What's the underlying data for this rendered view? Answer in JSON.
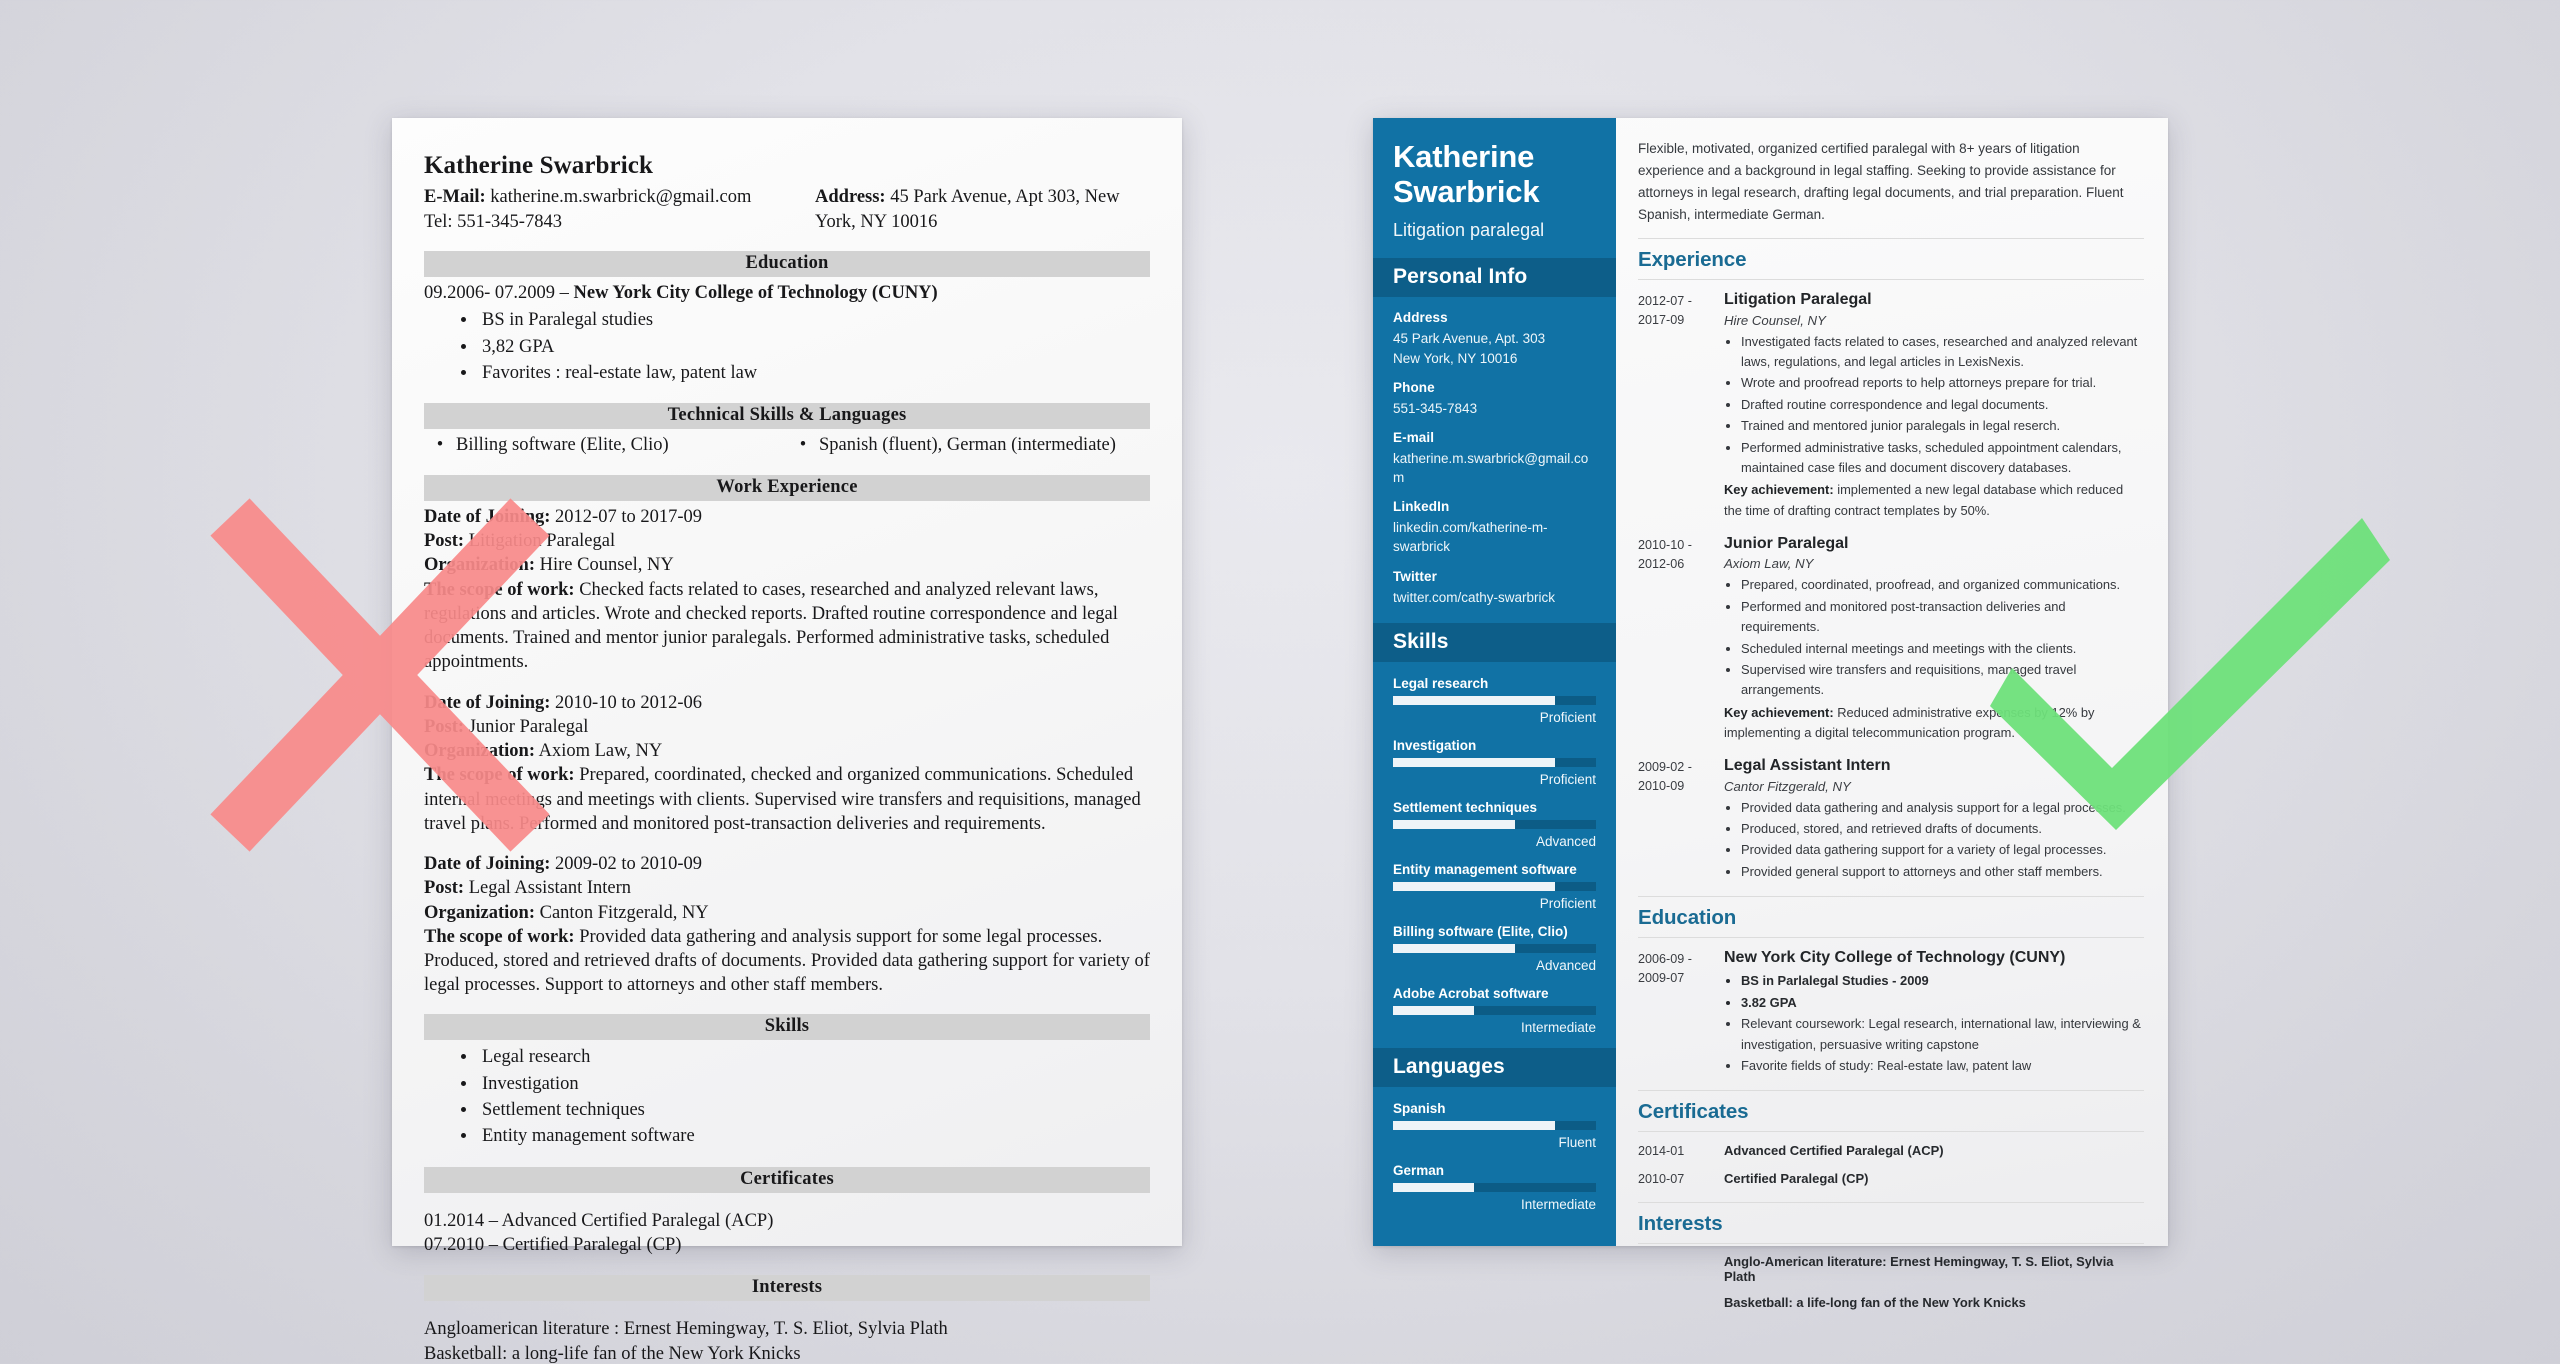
{
  "colors": {
    "sidebar_blue": "#1172a5",
    "sidebar_head_blue": "#0d5e89",
    "heading_blue": "#1a6b93",
    "bad_section_gray": "#d2d2d2",
    "cross_red": "#f98a8a",
    "check_green": "#6ee07a"
  },
  "bad_resume": {
    "name": "Katherine Swarbrick",
    "email_line": "E-Mail: katherine.m.swarbrick@gmail.com",
    "email_label": "E-Mail:",
    "email_value": " katherine.m.swarbrick@gmail.com",
    "tel_line": "Tel: 551-345-7843",
    "address_label": "Address:",
    "address_value": " 45 Park Avenue, Apt 303, New York, NY 10016",
    "sections": {
      "education_head": "Education",
      "education_line": "09.2006- 07.2009 – ",
      "education_school": "New York City College of Technology (CUNY)",
      "education_bullets": [
        "BS in Paralegal studies",
        "3,82 GPA",
        "Favorites : real-estate law, patent law"
      ],
      "tech_head": "Technical Skills & Languages",
      "tech_left": "Billing software (Elite, Clio)",
      "tech_right": "Spanish (fluent), German (intermediate)",
      "work_head": "Work Experience",
      "skills_head": "Skills",
      "skills_bullets": [
        "Legal research",
        "Investigation",
        "Settlement techniques",
        "Entity management software"
      ],
      "certificates_head": "Certificates",
      "certificates_lines": [
        "01.2014 – Advanced Certified Paralegal (ACP)",
        "07.2010 – Certified Paralegal (CP)"
      ],
      "interests_head": "Interests",
      "interests_lines": [
        "Angloamerican literature : Ernest Hemingway, T. S. Eliot, Sylvia Plath",
        "Basketball: a long-life fan of the New York Knicks"
      ]
    },
    "jobs": [
      {
        "date_label": "Date of Joining:",
        "date_value": " 2012-07 to 2017-09",
        "post_label": "Post:",
        "post_value": " Litigation Paralegal",
        "org_label": "Organization:",
        "org_value": " Hire Counsel, NY",
        "scope_label": "The scope of work:",
        "scope_value": " Checked facts related to cases, researched and analyzed relevant laws, regulations and articles. Wrote and checked reports. Drafted routine correspondence and legal documents. Trained and mentor junior paralegals. Performed administrative tasks, scheduled appointments."
      },
      {
        "date_label": "Date of Joining:",
        "date_value": " 2010-10 to 2012-06",
        "post_label": "Post:",
        "post_value": " Junior Paralegal",
        "org_label": "Organization:",
        "org_value": " Axiom Law, NY",
        "scope_label": "The scope of work:",
        "scope_value": " Prepared, coordinated, checked and organized communications. Scheduled internal meetings and meetings with clients. Supervised wire transfers and requisitions, managed travel plans. Performed and monitored post-transaction deliveries and requirements."
      },
      {
        "date_label": "Date of Joining:",
        "date_value": " 2009-02 to 2010-09",
        "post_label": "Post:",
        "post_value": " Legal Assistant Intern",
        "org_label": "Organization:",
        "org_value": " Canton Fitzgerald, NY",
        "scope_label": "The scope of work:",
        "scope_value": " Provided data gathering and analysis support for some legal processes. Produced, stored and retrieved drafts of documents. Provided data gathering support for variety of legal processes. Support to attorneys and other staff members."
      }
    ]
  },
  "good_resume": {
    "sidebar": {
      "name": "Katherine Swarbrick",
      "title": "Litigation paralegal",
      "personal_info_head": "Personal Info",
      "fields": [
        {
          "label": "Address",
          "value": "45 Park Avenue, Apt. 303\nNew York, NY 10016"
        },
        {
          "label": "Phone",
          "value": "551-345-7843"
        },
        {
          "label": "E-mail",
          "value": "katherine.m.swarbrick@gmail.com"
        },
        {
          "label": "LinkedIn",
          "value": "linkedin.com/katherine-m-swarbrick"
        },
        {
          "label": "Twitter",
          "value": "twitter.com/cathy-swarbrick"
        }
      ],
      "skills_head": "Skills",
      "skills": [
        {
          "name": "Legal research",
          "level": "Proficient",
          "percent": 80
        },
        {
          "name": "Investigation",
          "level": "Proficient",
          "percent": 80
        },
        {
          "name": "Settlement techniques",
          "level": "Advanced",
          "percent": 60
        },
        {
          "name": "Entity management software",
          "level": "Proficient",
          "percent": 80
        },
        {
          "name": "Billing software (Elite, Clio)",
          "level": "Advanced",
          "percent": 60
        },
        {
          "name": "Adobe Acrobat software",
          "level": "Intermediate",
          "percent": 40
        }
      ],
      "languages_head": "Languages",
      "languages": [
        {
          "name": "Spanish",
          "level": "Fluent",
          "percent": 80
        },
        {
          "name": "German",
          "level": "Intermediate",
          "percent": 40
        }
      ]
    },
    "main": {
      "summary": "Flexible, motivated, organized certified paralegal with 8+ years of litigation experience and a background in legal staffing. Seeking to provide assistance for attorneys in legal research, drafting legal documents, and trial preparation. Fluent Spanish, intermediate German.",
      "experience_head": "Experience",
      "experience": [
        {
          "dates": "2012-07 -\n2017-09",
          "title": "Litigation Paralegal",
          "company": "Hire Counsel, NY",
          "bullets": [
            "Investigated facts related to cases, researched and analyzed relevant laws, regulations, and legal articles in LexisNexis.",
            "Wrote and proofread reports to help attorneys prepare for trial.",
            "Drafted routine correspondence and legal documents.",
            "Trained and mentored junior paralegals in legal reserch.",
            "Performed administrative tasks, scheduled appointment calendars, maintained case files and document discovery databases."
          ],
          "key_label": "Key achievement:",
          "key_value": " implemented a new legal database which reduced the time of drafting contract templates by 50%."
        },
        {
          "dates": "2010-10 -\n2012-06",
          "title": "Junior Paralegal",
          "company": "Axiom Law, NY",
          "bullets": [
            "Prepared, coordinated, proofread, and organized communications.",
            "Performed and monitored post-transaction deliveries and requirements.",
            "Scheduled internal meetings and meetings with the clients.",
            "Supervised wire transfers and requisitions, managed travel arrangements."
          ],
          "key_label": "Key achievement:",
          "key_value": " Reduced administrative expenses by 12% by implementing a digital telecommunication program."
        },
        {
          "dates": "2009-02 -\n2010-09",
          "title": "Legal Assistant Intern",
          "company": "Cantor Fitzgerald, NY",
          "bullets": [
            "Provided data gathering and analysis support for a legal processes.",
            "Produced, stored, and retrieved drafts of documents.",
            "Provided data gathering support for a variety of legal processes.",
            "Provided general support to attorneys and other staff members."
          ],
          "key_label": "",
          "key_value": ""
        }
      ],
      "education_head": "Education",
      "education": {
        "dates": "2006-09 -\n2009-07",
        "school": "New York City College of Technology (CUNY)",
        "bullets": [
          {
            "text": "BS in Parlalegal Studies - 2009",
            "bold": true
          },
          {
            "text": "3.82 GPA",
            "bold": true
          },
          {
            "text": "Relevant coursework: Legal research, international law, interviewing & investigation, persuasive writing capstone",
            "bold": false
          },
          {
            "text": "Favorite fields of study: Real-estate law, patent law",
            "bold": false
          }
        ]
      },
      "certificates_head": "Certificates",
      "certificates": [
        {
          "date": "2014-01",
          "name": "Advanced Certified Paralegal (ACP)"
        },
        {
          "date": "2010-07",
          "name": "Certified Paralegal (CP)"
        }
      ],
      "interests_head": "Interests",
      "interests": [
        "Anglo-American literature: Ernest Hemingway, T. S. Eliot, Sylvia Plath",
        "Basketball: a life-long fan of the New York Knicks"
      ]
    }
  },
  "marks": {
    "cross": "cross-mark-red",
    "check": "check-mark-green"
  }
}
